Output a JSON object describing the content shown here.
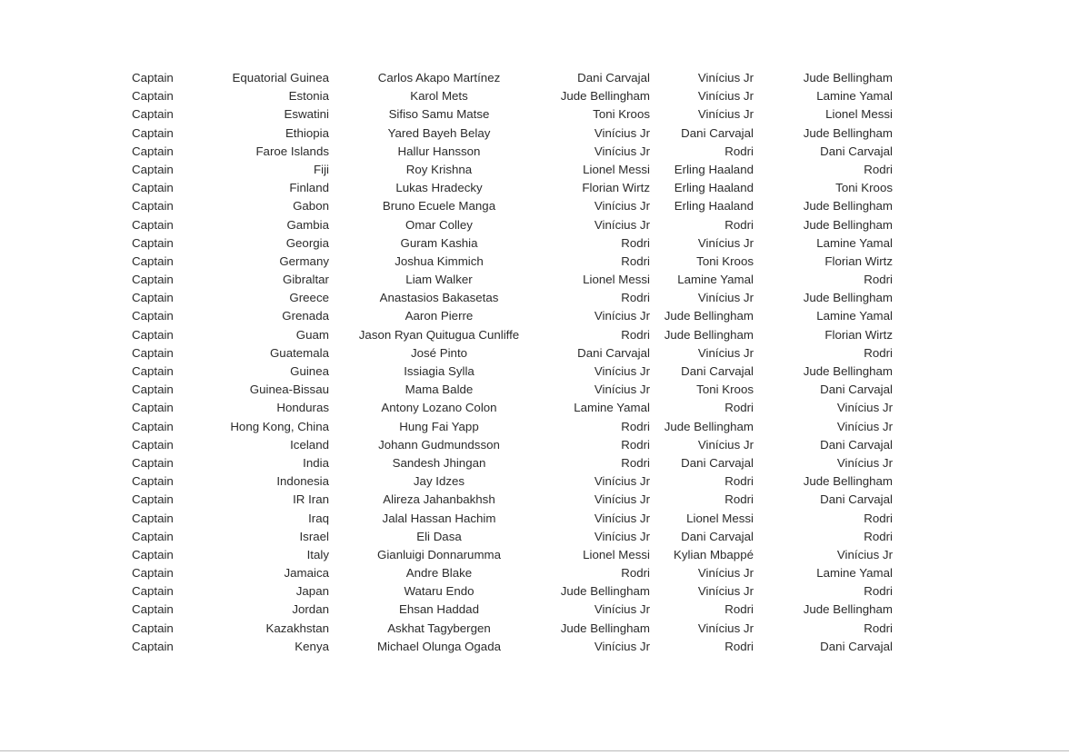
{
  "document": {
    "background_color": "#ffffff",
    "text_color": "#2b2b2b",
    "rule_color": "#b9b9b9"
  },
  "table": {
    "columns": [
      {
        "key": "role",
        "align": "left",
        "name": "role-column"
      },
      {
        "key": "country",
        "align": "right",
        "name": "country-column"
      },
      {
        "key": "captain",
        "align": "center",
        "name": "captain-name-column"
      },
      {
        "key": "player1",
        "align": "right",
        "name": "player-1-column"
      },
      {
        "key": "player2",
        "align": "right",
        "name": "player-2-column"
      },
      {
        "key": "player3",
        "align": "right",
        "name": "player-3-column"
      }
    ],
    "rows": [
      {
        "role": "Captain",
        "country": "Equatorial Guinea",
        "captain": "Carlos Akapo Martínez",
        "player1": "Dani Carvajal",
        "player2": "Vinícius Jr",
        "player3": "Jude Bellingham"
      },
      {
        "role": "Captain",
        "country": "Estonia",
        "captain": "Karol Mets",
        "player1": "Jude Bellingham",
        "player2": "Vinícius Jr",
        "player3": "Lamine Yamal"
      },
      {
        "role": "Captain",
        "country": "Eswatini",
        "captain": "Sifiso Samu Matse",
        "player1": "Toni Kroos",
        "player2": "Vinícius Jr",
        "player3": "Lionel Messi"
      },
      {
        "role": "Captain",
        "country": "Ethiopia",
        "captain": "Yared Bayeh Belay",
        "player1": "Vinícius Jr",
        "player2": "Dani Carvajal",
        "player3": "Jude Bellingham"
      },
      {
        "role": "Captain",
        "country": "Faroe Islands",
        "captain": "Hallur Hansson",
        "player1": "Vinícius Jr",
        "player2": "Rodri",
        "player3": "Dani Carvajal"
      },
      {
        "role": "Captain",
        "country": "Fiji",
        "captain": "Roy Krishna",
        "player1": "Lionel Messi",
        "player2": "Erling Haaland",
        "player3": "Rodri"
      },
      {
        "role": "Captain",
        "country": "Finland",
        "captain": "Lukas Hradecky",
        "player1": "Florian Wirtz",
        "player2": "Erling Haaland",
        "player3": "Toni Kroos"
      },
      {
        "role": "Captain",
        "country": "Gabon",
        "captain": "Bruno Ecuele Manga",
        "player1": "Vinícius Jr",
        "player2": "Erling Haaland",
        "player3": "Jude Bellingham"
      },
      {
        "role": "Captain",
        "country": "Gambia",
        "captain": "Omar Colley",
        "player1": "Vinícius Jr",
        "player2": "Rodri",
        "player3": "Jude Bellingham"
      },
      {
        "role": "Captain",
        "country": "Georgia",
        "captain": "Guram Kashia",
        "player1": "Rodri",
        "player2": "Vinícius Jr",
        "player3": "Lamine Yamal"
      },
      {
        "role": "Captain",
        "country": "Germany",
        "captain": "Joshua Kimmich",
        "player1": "Rodri",
        "player2": "Toni Kroos",
        "player3": "Florian Wirtz"
      },
      {
        "role": "Captain",
        "country": "Gibraltar",
        "captain": "Liam Walker",
        "player1": "Lionel Messi",
        "player2": "Lamine Yamal",
        "player3": "Rodri"
      },
      {
        "role": "Captain",
        "country": "Greece",
        "captain": "Anastasios Bakasetas",
        "player1": "Rodri",
        "player2": "Vinícius Jr",
        "player3": "Jude Bellingham"
      },
      {
        "role": "Captain",
        "country": "Grenada",
        "captain": "Aaron Pierre",
        "player1": "Vinícius Jr",
        "player2": "Jude Bellingham",
        "player3": "Lamine Yamal"
      },
      {
        "role": "Captain",
        "country": "Guam",
        "captain": "Jason Ryan Quitugua Cunliffe",
        "player1": "Rodri",
        "player2": "Jude Bellingham",
        "player3": "Florian Wirtz"
      },
      {
        "role": "Captain",
        "country": "Guatemala",
        "captain": "José Pinto",
        "player1": "Dani Carvajal",
        "player2": "Vinícius Jr",
        "player3": "Rodri"
      },
      {
        "role": "Captain",
        "country": "Guinea",
        "captain": "Issiagia Sylla",
        "player1": "Vinícius Jr",
        "player2": "Dani Carvajal",
        "player3": "Jude Bellingham"
      },
      {
        "role": "Captain",
        "country": "Guinea-Bissau",
        "captain": "Mama Balde",
        "player1": "Vinícius Jr",
        "player2": "Toni Kroos",
        "player3": "Dani Carvajal"
      },
      {
        "role": "Captain",
        "country": "Honduras",
        "captain": "Antony Lozano Colon",
        "player1": "Lamine Yamal",
        "player2": "Rodri",
        "player3": "Vinícius Jr"
      },
      {
        "role": "Captain",
        "country": "Hong Kong, China",
        "captain": "Hung Fai Yapp",
        "player1": "Rodri",
        "player2": "Jude Bellingham",
        "player3": "Vinícius Jr"
      },
      {
        "role": "Captain",
        "country": "Iceland",
        "captain": "Johann Gudmundsson",
        "player1": "Rodri",
        "player2": "Vinícius Jr",
        "player3": "Dani Carvajal"
      },
      {
        "role": "Captain",
        "country": "India",
        "captain": "Sandesh Jhingan",
        "player1": "Rodri",
        "player2": "Dani Carvajal",
        "player3": "Vinícius Jr"
      },
      {
        "role": "Captain",
        "country": "Indonesia",
        "captain": "Jay Idzes",
        "player1": "Vinícius Jr",
        "player2": "Rodri",
        "player3": "Jude Bellingham"
      },
      {
        "role": "Captain",
        "country": "IR Iran",
        "captain": "Alireza Jahanbakhsh",
        "player1": "Vinícius Jr",
        "player2": "Rodri",
        "player3": "Dani Carvajal"
      },
      {
        "role": "Captain",
        "country": "Iraq",
        "captain": "Jalal Hassan Hachim",
        "player1": "Vinícius Jr",
        "player2": "Lionel Messi",
        "player3": "Rodri"
      },
      {
        "role": "Captain",
        "country": "Israel",
        "captain": "Eli Dasa",
        "player1": "Vinícius Jr",
        "player2": "Dani Carvajal",
        "player3": "Rodri"
      },
      {
        "role": "Captain",
        "country": "Italy",
        "captain": "Gianluigi Donnarumma",
        "player1": "Lionel Messi",
        "player2": "Kylian Mbappé",
        "player3": "Vinícius Jr"
      },
      {
        "role": "Captain",
        "country": "Jamaica",
        "captain": "Andre Blake",
        "player1": "Rodri",
        "player2": "Vinícius Jr",
        "player3": "Lamine Yamal"
      },
      {
        "role": "Captain",
        "country": "Japan",
        "captain": "Wataru Endo",
        "player1": "Jude Bellingham",
        "player2": "Vinícius Jr",
        "player3": "Rodri"
      },
      {
        "role": "Captain",
        "country": "Jordan",
        "captain": "Ehsan Haddad",
        "player1": "Vinícius Jr",
        "player2": "Rodri",
        "player3": "Jude Bellingham"
      },
      {
        "role": "Captain",
        "country": "Kazakhstan",
        "captain": "Askhat Tagybergen",
        "player1": "Jude Bellingham",
        "player2": "Vinícius Jr",
        "player3": "Rodri"
      },
      {
        "role": "Captain",
        "country": "Kenya",
        "captain": "Michael Olunga Ogada",
        "player1": "Vinícius Jr",
        "player2": "Rodri",
        "player3": "Dani Carvajal"
      }
    ]
  }
}
